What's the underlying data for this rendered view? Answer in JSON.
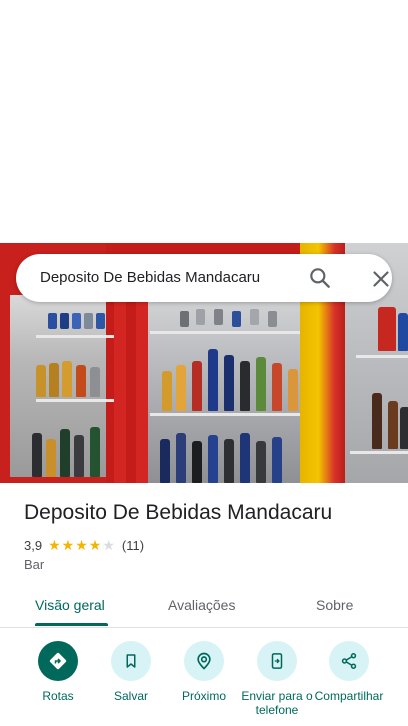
{
  "search": {
    "query": "Deposito De Bebidas Mandacaru"
  },
  "place": {
    "title": "Deposito De Bebidas Mandacaru",
    "rating": "3,9",
    "stars_filled": 4,
    "stars_total": 5,
    "review_count": "(11)",
    "category": "Bar"
  },
  "tabs": [
    {
      "label": "Visão geral",
      "active": true
    },
    {
      "label": "Avaliações",
      "active": false
    },
    {
      "label": "Sobre",
      "active": false
    }
  ],
  "actions": [
    {
      "label": "Rotas",
      "icon": "directions-icon"
    },
    {
      "label": "Salvar",
      "icon": "bookmark-icon"
    },
    {
      "label": "Próximo",
      "icon": "nearby-icon"
    },
    {
      "label": "Enviar para o telefone",
      "icon": "send-to-phone-icon"
    },
    {
      "label": "Compartilhar",
      "icon": "share-icon"
    }
  ],
  "colors": {
    "accent": "#00695c",
    "action_bg": "#d7f3f5",
    "star": "#f4b400"
  }
}
